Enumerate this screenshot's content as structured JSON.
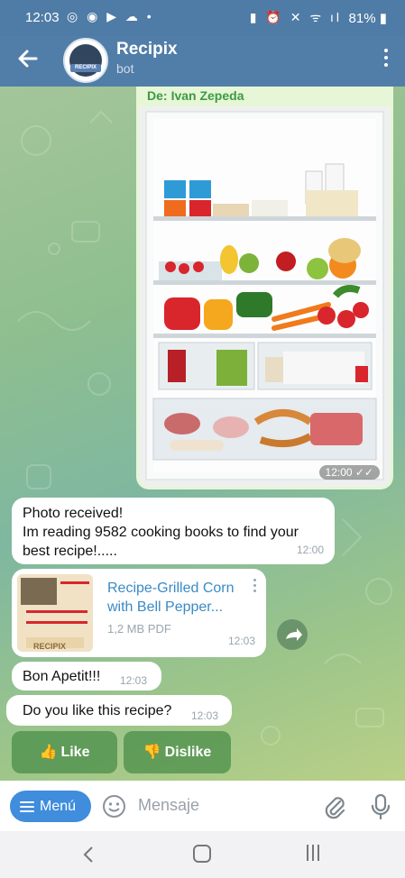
{
  "status_bar": {
    "time": "12:03",
    "battery": "81%"
  },
  "header": {
    "title": "Recipix",
    "subtitle": "bot",
    "avatar_logo_text": "RECIPIX"
  },
  "messages": {
    "photo": {
      "forwarded_prefix": "De:",
      "forwarded_from": "Ivan Zepeda",
      "time": "12:00"
    },
    "received": {
      "line1": "Photo received!",
      "line2": "Im reading 9582 cooking books to find your best recipe!.....",
      "time": "12:00"
    },
    "document": {
      "name": "Recipe-Grilled Corn with Bell Pepper...",
      "meta": "1,2 MB PDF",
      "time": "12:03",
      "thumb_text": "RECIPIX"
    },
    "bon_apetit": {
      "text": "Bon Apetit!!!",
      "time": "12:03"
    },
    "question": {
      "text": "Do you like this recipe?",
      "time": "12:03"
    }
  },
  "keyboard": {
    "like": {
      "emoji": "👍",
      "label": "Like"
    },
    "dislike": {
      "emoji": "👎",
      "label": "Dislike"
    }
  },
  "input": {
    "menu_label": "Menú",
    "placeholder": "Mensaje"
  },
  "icons": [
    "back-arrow-icon",
    "kebab-menu-icon",
    "share-icon",
    "emoji-icon",
    "attach-icon",
    "mic-icon"
  ],
  "colors": {
    "header": "#517ea8",
    "outgoing_bubble": "#e6f6d6",
    "link": "#3a8bc4",
    "menu_button": "#3f8ddc",
    "forward_name": "#3c9a44"
  }
}
